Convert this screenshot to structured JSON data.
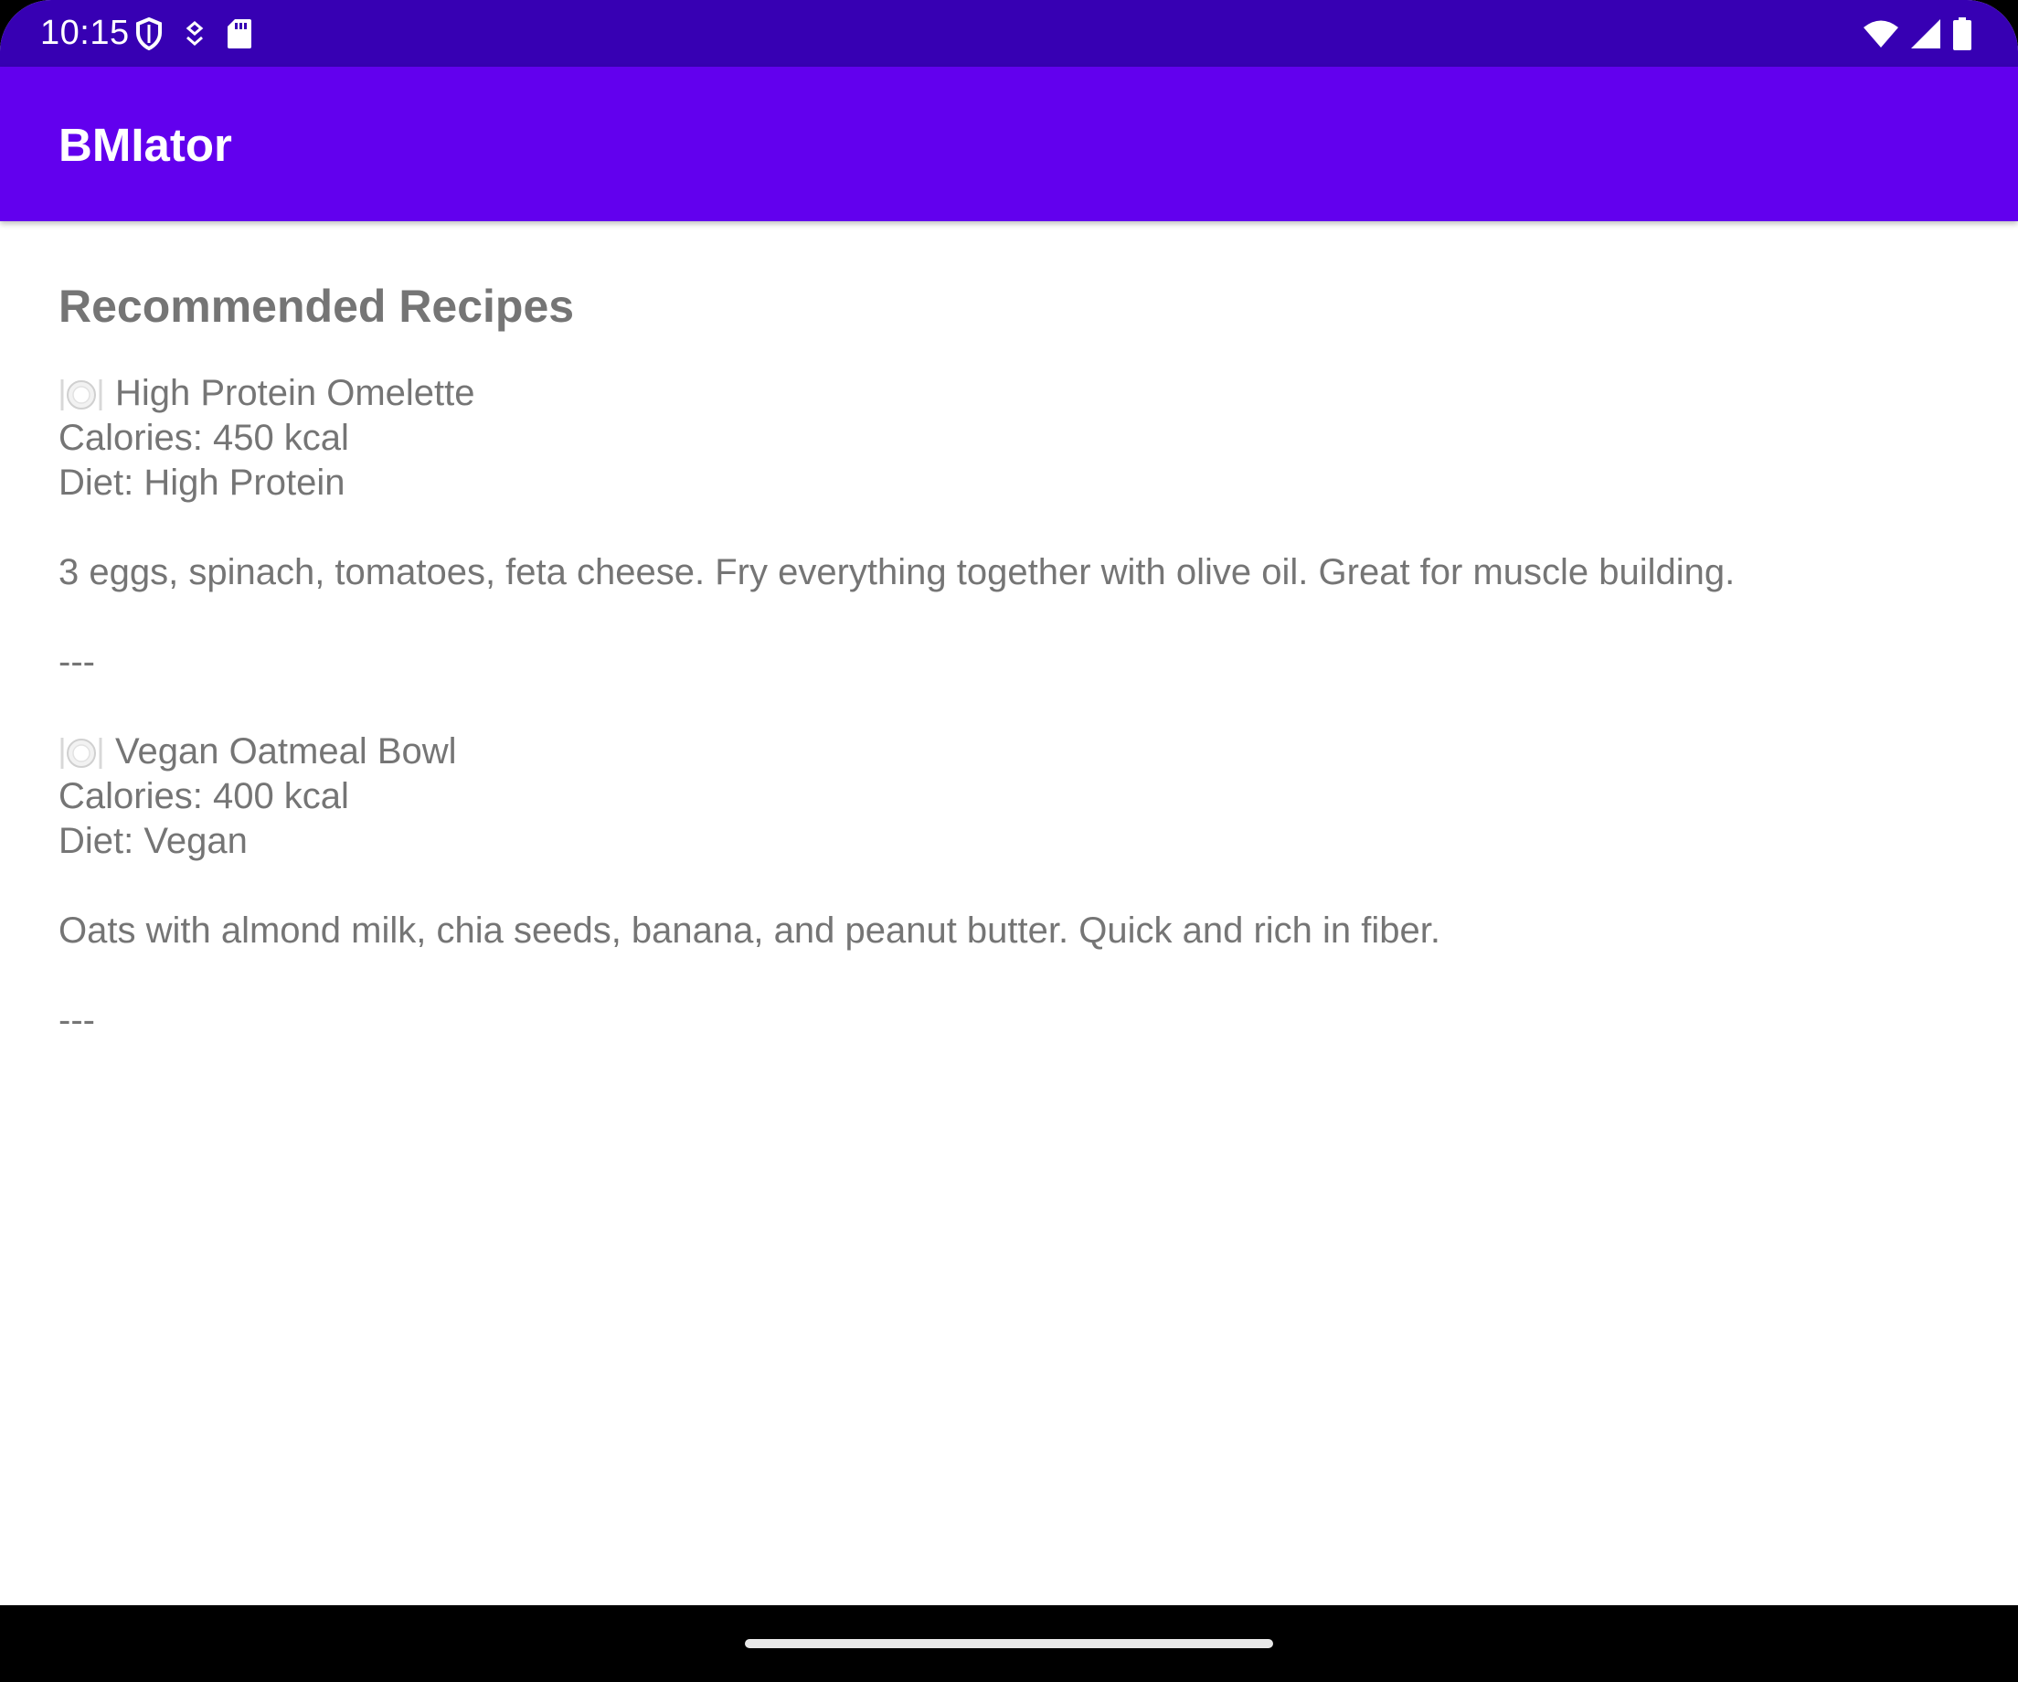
{
  "status_bar": {
    "time": "10:15",
    "left_icons": [
      "shield-icon",
      "location-pin-icon",
      "sd-card-icon"
    ],
    "right_icons": [
      "wifi-icon",
      "cellular-signal-icon",
      "battery-icon"
    ],
    "background": "#3700b3"
  },
  "app_bar": {
    "title": "BMIator",
    "background": "#6200ee"
  },
  "content": {
    "section_title": "Recommended Recipes",
    "recipes": [
      {
        "icon": "plate-cutlery-icon",
        "name": "High Protein Omelette",
        "calories": "Calories: 450 kcal",
        "diet": "Diet: High Protein",
        "description": "3 eggs, spinach, tomatoes, feta cheese. Fry everything together with olive oil. Great for muscle building.",
        "separator": "---"
      },
      {
        "icon": "plate-cutlery-icon",
        "name": "Vegan Oatmeal Bowl",
        "calories": "Calories: 400 kcal",
        "diet": "Diet: Vegan",
        "description": "Oats with almond milk, chia seeds, banana, and peanut butter. Quick and rich in fiber.",
        "separator": "---"
      }
    ],
    "text_color": "#757575"
  },
  "nav_bar": {
    "handle": "home-handle"
  }
}
